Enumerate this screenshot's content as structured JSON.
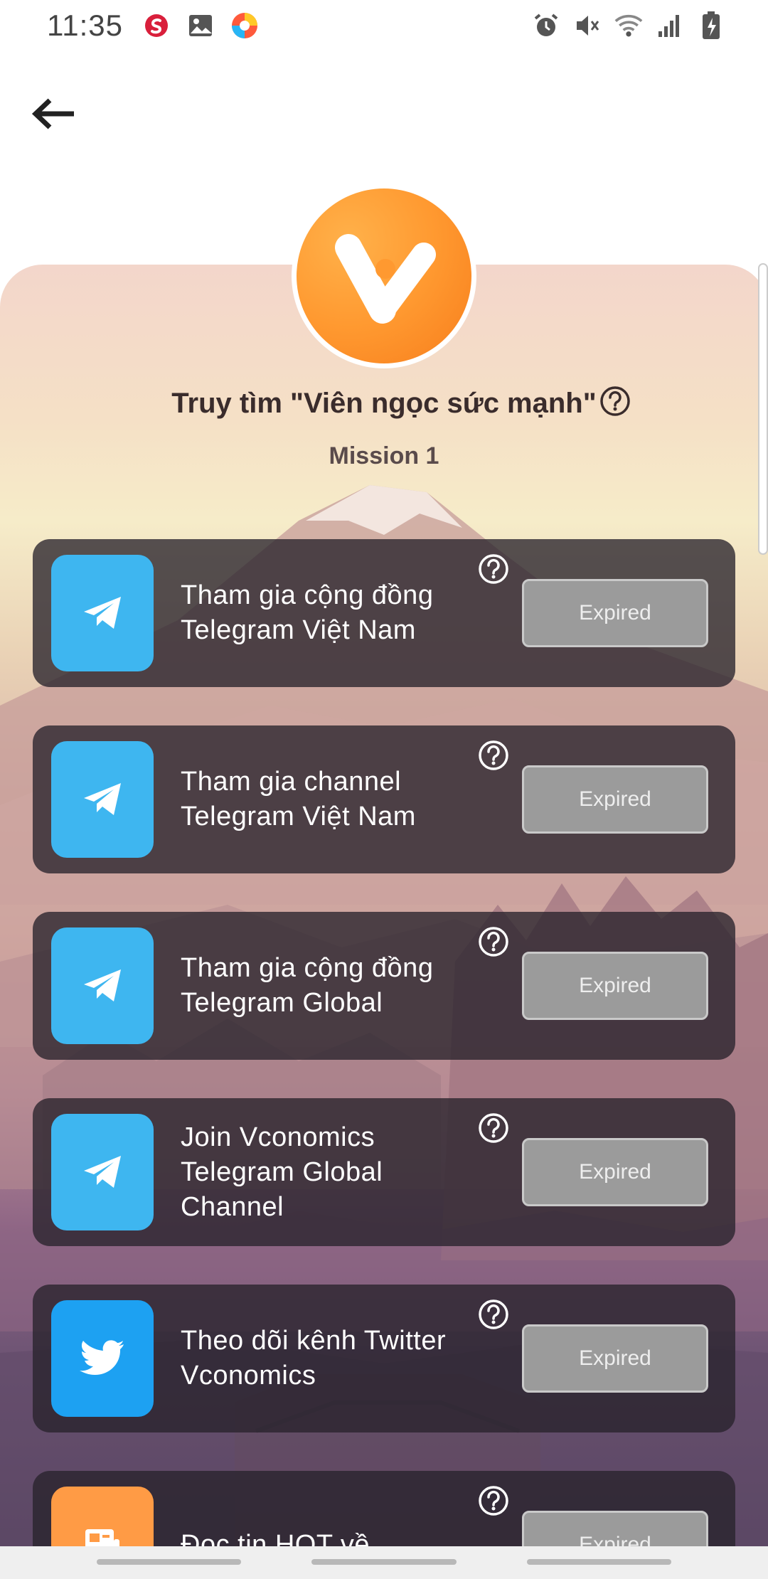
{
  "status_bar": {
    "time": "11:35",
    "left_icons": [
      "sendo-icon",
      "gallery-icon",
      "browser-icon"
    ],
    "right_icons": [
      "alarm-icon",
      "mute-icon",
      "wifi-icon",
      "signal-icon",
      "battery-charging-icon"
    ]
  },
  "header": {
    "back_icon": "arrow-left-icon"
  },
  "campaign": {
    "title": "Truy tìm \"Viên ngọc sức mạnh\"",
    "subtitle": "Mission 1",
    "logo_icon": "v-logo-icon"
  },
  "tasks": [
    {
      "label": "Tham gia cộng đồng Telegram Việt Nam",
      "icon": "telegram-icon",
      "icon_color": "#3EB6F0",
      "button": "Expired"
    },
    {
      "label": "Tham gia channel Telegram Việt Nam",
      "icon": "telegram-icon",
      "icon_color": "#3EB6F0",
      "button": "Expired"
    },
    {
      "label": "Tham gia cộng đồng Telegram Global",
      "icon": "telegram-icon",
      "icon_color": "#3EB6F0",
      "button": "Expired"
    },
    {
      "label": "Join Vconomics Telegram Global Channel",
      "icon": "telegram-icon",
      "icon_color": "#3EB6F0",
      "button": "Expired"
    },
    {
      "label": "Theo dõi kênh Twitter Vconomics",
      "icon": "twitter-icon",
      "icon_color": "#1DA1F2",
      "button": "Expired"
    },
    {
      "label": "Đọc tin HOT về",
      "icon": "news-icon",
      "icon_color": "#FF9B45",
      "button": "Expired"
    }
  ],
  "colors": {
    "accent": "#FF9930",
    "button_disabled": "#9B9B9B"
  }
}
